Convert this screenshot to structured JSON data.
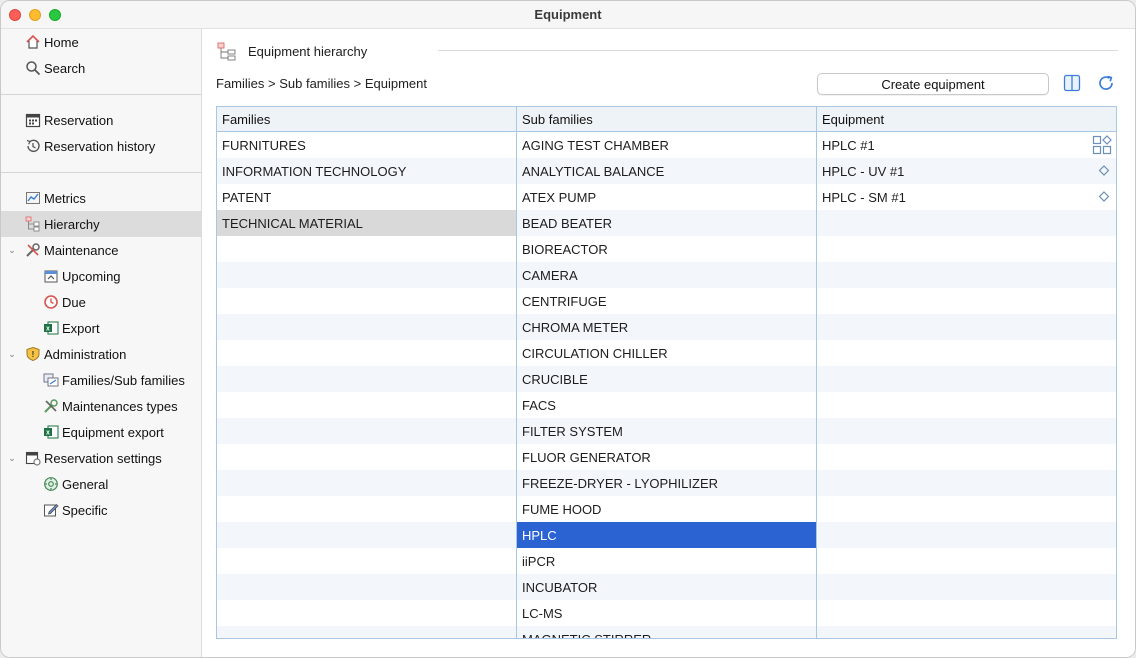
{
  "window": {
    "title": "Equipment"
  },
  "sidebar": {
    "items": [
      {
        "label": "Home",
        "icon": "home-icon"
      },
      {
        "label": "Search",
        "icon": "search-icon"
      },
      {
        "label": "Reservation",
        "icon": "calendar-icon"
      },
      {
        "label": "Reservation history",
        "icon": "history-icon"
      },
      {
        "label": "Metrics",
        "icon": "chart-icon"
      },
      {
        "label": "Hierarchy",
        "icon": "hierarchy-icon"
      },
      {
        "label": "Maintenance",
        "icon": "tools-icon"
      },
      {
        "label": "Upcoming",
        "icon": "upcoming-icon"
      },
      {
        "label": "Due",
        "icon": "due-clock-icon"
      },
      {
        "label": "Export",
        "icon": "excel-icon"
      },
      {
        "label": "Administration",
        "icon": "shield-icon"
      },
      {
        "label": "Families/Sub families",
        "icon": "families-icon"
      },
      {
        "label": "Maintenances types",
        "icon": "tools-icon"
      },
      {
        "label": "Equipment export",
        "icon": "excel-icon"
      },
      {
        "label": "Reservation settings",
        "icon": "calendar-settings-icon"
      },
      {
        "label": "General",
        "icon": "general-settings-icon"
      },
      {
        "label": "Specific",
        "icon": "edit-icon"
      }
    ],
    "selected": "Hierarchy"
  },
  "header": {
    "title": "Equipment hierarchy",
    "breadcrumb": "Families > Sub families > Equipment",
    "create_button": "Create equipment"
  },
  "table": {
    "families": {
      "header": "Families",
      "rows": [
        "FURNITURES",
        "INFORMATION TECHNOLOGY",
        "PATENT",
        "TECHNICAL MATERIAL"
      ],
      "selected": "TECHNICAL MATERIAL"
    },
    "sub_families": {
      "header": "Sub families",
      "rows": [
        "AGING TEST CHAMBER",
        "ANALYTICAL BALANCE",
        "ATEX PUMP",
        "BEAD BEATER",
        "BIOREACTOR",
        "CAMERA",
        "CENTRIFUGE",
        "CHROMA METER",
        "CIRCULATION CHILLER",
        "CRUCIBLE",
        "FACS",
        "FILTER SYSTEM",
        "FLUOR GENERATOR",
        "FREEZE-DRYER - LYOPHILIZER",
        "FUME HOOD",
        "HPLC",
        "iiPCR",
        "INCUBATOR",
        "LC-MS",
        "MAGNETIC STIRRER"
      ],
      "selected": "HPLC"
    },
    "equipment": {
      "header": "Equipment",
      "rows": [
        "HPLC #1",
        "HPLC - UV #1",
        "HPLC - SM #1"
      ]
    }
  },
  "colors": {
    "selection_blue": "#2b63d3",
    "grid_border": "#a9c7e3",
    "header_bg": "#eef3f8"
  }
}
